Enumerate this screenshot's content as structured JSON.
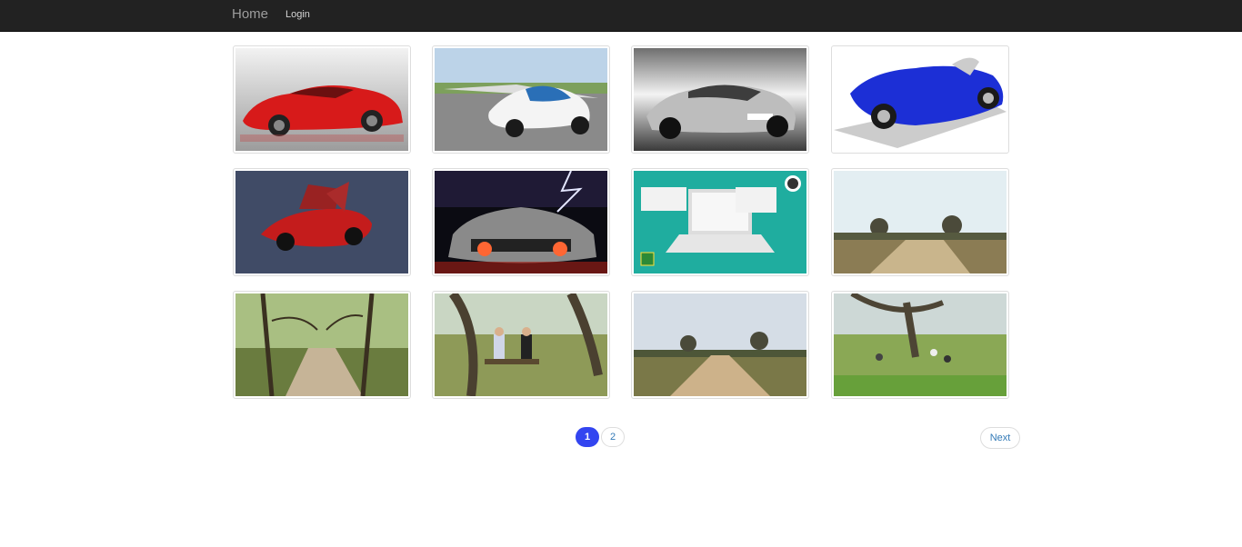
{
  "navbar": {
    "brand": "Home",
    "login": "Login"
  },
  "gallery": {
    "images": [
      {
        "subject": "red sports car"
      },
      {
        "subject": "flying car on runway"
      },
      {
        "subject": "silver sports car"
      },
      {
        "subject": "blue roadster"
      },
      {
        "subject": "red gullwing concept car"
      },
      {
        "subject": "supercar rear with lightning"
      },
      {
        "subject": "laptop illustration"
      },
      {
        "subject": "open field with trees"
      },
      {
        "subject": "tree lined path"
      },
      {
        "subject": "two people sitting on bench"
      },
      {
        "subject": "dirt path across meadow"
      },
      {
        "subject": "group sitting in park"
      }
    ]
  },
  "pagination": {
    "pages": [
      "1",
      "2"
    ],
    "active": "1",
    "next_label": "Next"
  },
  "colors": {
    "navbar": "#222222",
    "active_page": "#3345f0",
    "link": "#337ab7"
  }
}
